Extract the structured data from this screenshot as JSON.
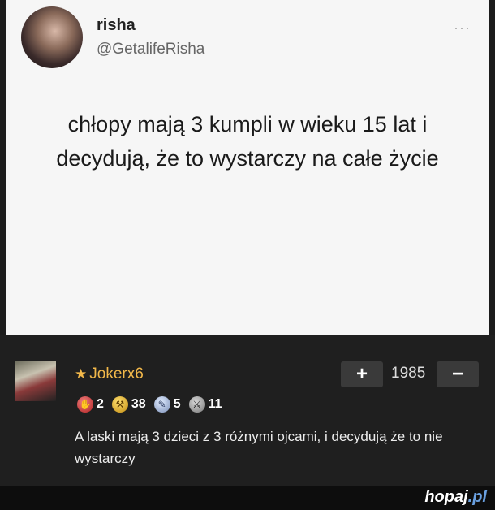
{
  "tweet": {
    "name": "risha",
    "handle": "@GetalifeRisha",
    "more": "···",
    "text_line1": "chłopy mają 3 kumpli w wieku 15 lat i",
    "text_line2": "decydują, że to wystarczy na całe życie"
  },
  "comment": {
    "username": "Jokerx6",
    "score": "1985",
    "plus": "+",
    "minus": "−",
    "badges": [
      {
        "icon": "middle-finger-icon",
        "count": "2"
      },
      {
        "icon": "gold-pickaxe-icon",
        "count": "38"
      },
      {
        "icon": "blue-pencil-icon",
        "count": "5"
      },
      {
        "icon": "gray-sword-icon",
        "count": "11"
      }
    ],
    "text": "A laski mają 3 dzieci z 3 różnymi ojcami, i decydują że to nie wystarczy"
  },
  "footer": {
    "logo_main": "hopaj",
    "logo_tld": ".pl"
  }
}
